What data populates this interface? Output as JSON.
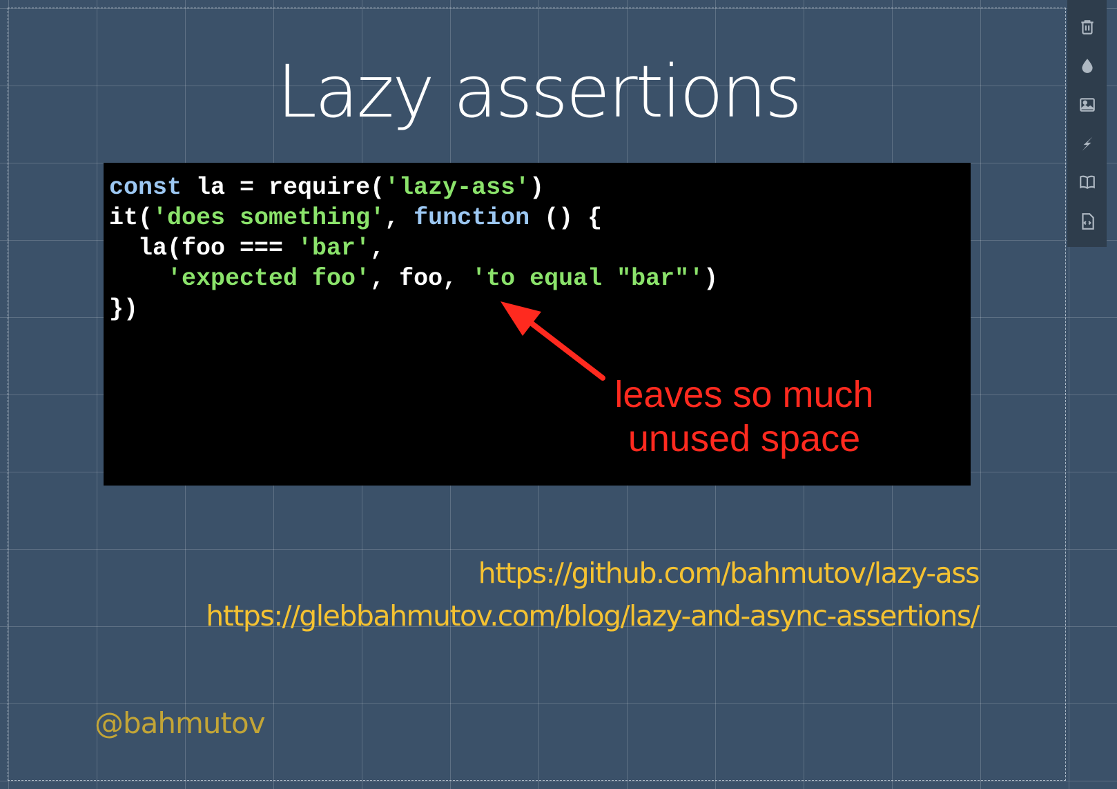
{
  "slide": {
    "title": "Lazy assertions",
    "code_lines": [
      [
        {
          "t": "kw",
          "v": "const"
        },
        {
          "t": "plain",
          "v": " la = require("
        },
        {
          "t": "str",
          "v": "'lazy-ass'"
        },
        {
          "t": "plain",
          "v": ")"
        }
      ],
      [
        {
          "t": "plain",
          "v": "it("
        },
        {
          "t": "str",
          "v": "'does something'"
        },
        {
          "t": "plain",
          "v": ", "
        },
        {
          "t": "kw",
          "v": "function"
        },
        {
          "t": "plain",
          "v": " () {"
        }
      ],
      [
        {
          "t": "plain",
          "v": "  la(foo === "
        },
        {
          "t": "str",
          "v": "'bar'"
        },
        {
          "t": "plain",
          "v": ","
        }
      ],
      [
        {
          "t": "plain",
          "v": "    "
        },
        {
          "t": "str",
          "v": "'expected foo'"
        },
        {
          "t": "plain",
          "v": ", foo, "
        },
        {
          "t": "str",
          "v": "'to equal \"bar\"'"
        },
        {
          "t": "plain",
          "v": ")"
        }
      ],
      [
        {
          "t": "plain",
          "v": "})"
        }
      ]
    ],
    "annotation": {
      "line1": "leaves so much",
      "line2": "unused space",
      "color": "#ff2a1f"
    },
    "links": [
      "https://github.com/bahmutov/lazy-ass",
      "https://glebbahmutov.com/blog/lazy-and-async-assertions/"
    ],
    "handle": "@bahmutov"
  },
  "colors": {
    "background": "#3b5169",
    "code_keyword": "#9cc7f2",
    "code_string": "#8be36b",
    "link": "#f5c231",
    "handle": "#c3a536"
  },
  "toolbar": {
    "buttons": [
      {
        "name": "trash-icon"
      },
      {
        "name": "droplet-icon"
      },
      {
        "name": "image-icon"
      },
      {
        "name": "lightning-icon"
      },
      {
        "name": "book-icon"
      },
      {
        "name": "code-file-icon"
      }
    ]
  }
}
